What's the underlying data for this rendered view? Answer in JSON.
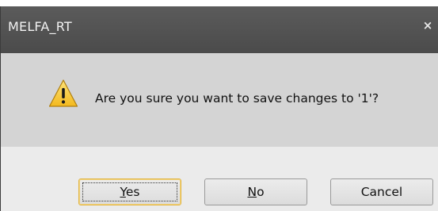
{
  "dialog": {
    "title": "MELFA_RT",
    "close_symbol": "×",
    "icon": "warning-icon",
    "message": "Are you sure you want to save changes to '1'?",
    "buttons": {
      "yes": {
        "mnemonic": "Y",
        "rest": "es"
      },
      "no": {
        "mnemonic": "N",
        "rest": "o"
      },
      "cancel": {
        "label": "Cancel"
      }
    },
    "colors": {
      "titlebar": "#4f4f4f",
      "message_bg": "#d4d4d4",
      "button_area_bg": "#ebebeb",
      "default_button_border": "#e2b53f",
      "warning_yellow": "#f7c52b"
    }
  }
}
